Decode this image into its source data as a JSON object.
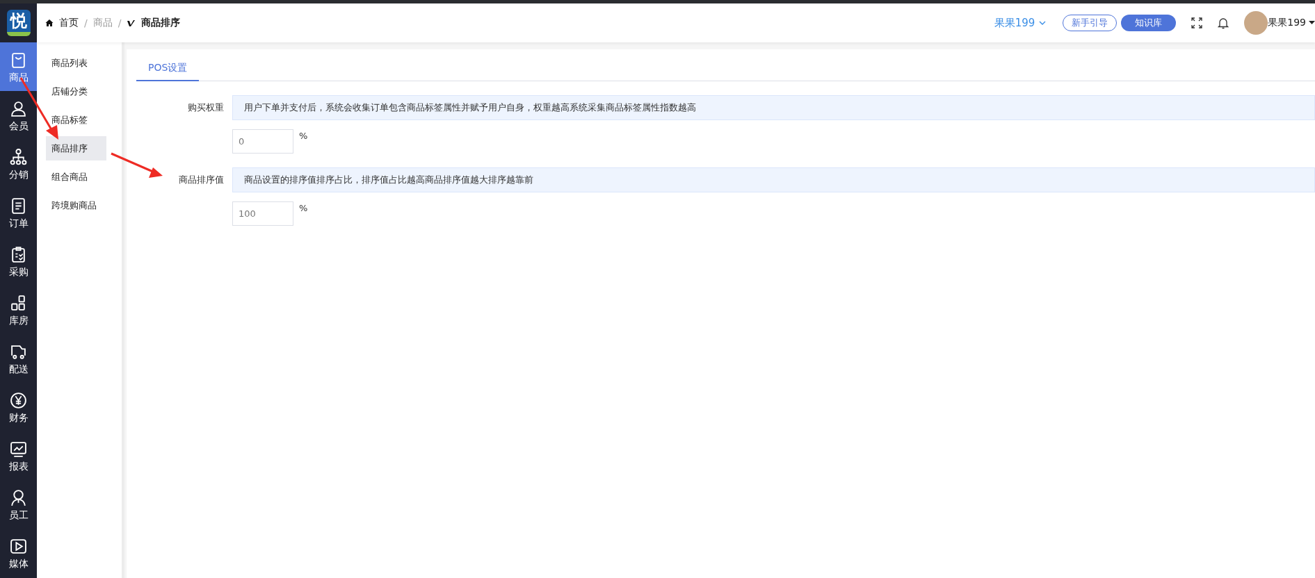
{
  "logo": {
    "text": "悦"
  },
  "nav": [
    {
      "label": "商品",
      "selected": true
    },
    {
      "label": "会员",
      "selected": false
    },
    {
      "label": "分销",
      "selected": false
    },
    {
      "label": "订单",
      "selected": false
    },
    {
      "label": "采购",
      "selected": false
    },
    {
      "label": "库房",
      "selected": false
    },
    {
      "label": "配送",
      "selected": false
    },
    {
      "label": "财务",
      "selected": false
    },
    {
      "label": "报表",
      "selected": false
    },
    {
      "label": "员工",
      "selected": false
    },
    {
      "label": "媒体",
      "selected": false
    }
  ],
  "breadcrumb": [
    {
      "label": "首页",
      "kind": "home",
      "separator": "/"
    },
    {
      "label": "商品",
      "kind": "link",
      "separator": "/"
    },
    {
      "label": "商品排序",
      "kind": "current"
    }
  ],
  "header": {
    "store": "果果199",
    "guide_button": "新手引导",
    "knowledge_button": "知识库",
    "user": "果果199"
  },
  "subnav": [
    {
      "label": "商品列表",
      "selected": false
    },
    {
      "label": "店铺分类",
      "selected": false
    },
    {
      "label": "商品标签",
      "selected": false
    },
    {
      "label": "商品排序",
      "selected": true
    },
    {
      "label": "组合商品",
      "selected": false
    },
    {
      "label": "跨境购商品",
      "selected": false
    }
  ],
  "tabs": [
    {
      "label": "POS设置",
      "selected": true
    }
  ],
  "form": [
    {
      "label": "购买权重",
      "info": "用户下单并支付后，系统会收集订单包含商品标签属性并赋予用户自身，权重越高系统采集商品标签属性指数越高",
      "value": "0",
      "unit": "%"
    },
    {
      "label": "商品排序值",
      "info": "商品设置的排序值排序占比，排序值占比越高商品排序值越大排序越靠前",
      "value": "100",
      "unit": "%"
    }
  ]
}
